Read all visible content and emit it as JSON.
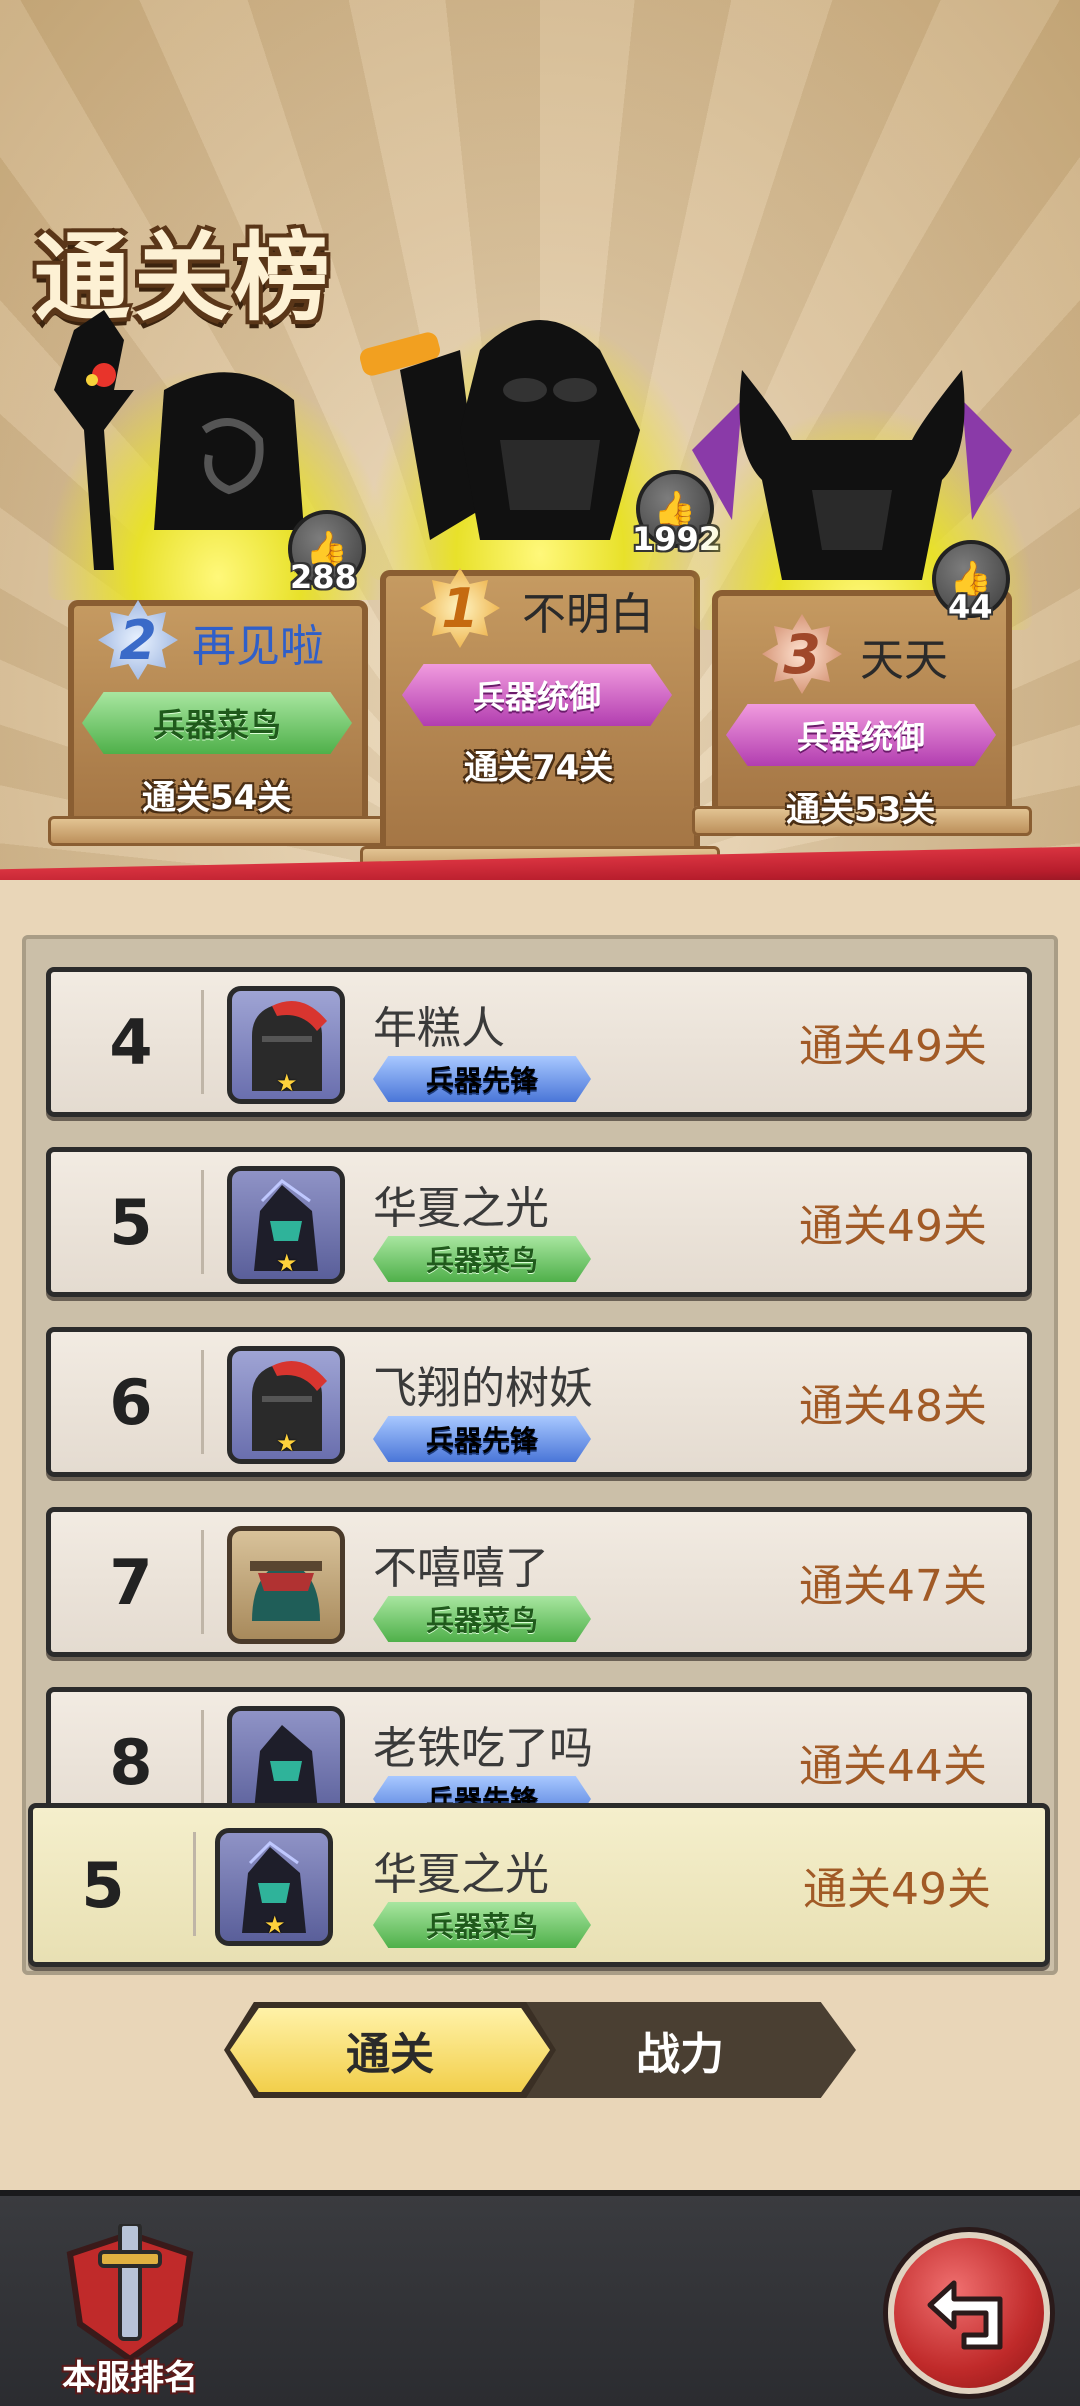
{
  "page": {
    "title": "通关榜"
  },
  "podium": [
    {
      "rank": "2",
      "name": "再见啦",
      "likes": "288",
      "title": "兵器菜鸟",
      "title_color": "green",
      "level": "通关54关"
    },
    {
      "rank": "1",
      "name": "不明白",
      "likes": "1992",
      "title": "兵器统御",
      "title_color": "purple",
      "level": "通关74关"
    },
    {
      "rank": "3",
      "name": "天天",
      "likes": "44",
      "title": "兵器统御",
      "title_color": "purple",
      "level": "通关53关"
    }
  ],
  "list": [
    {
      "rank": "4",
      "name": "年糕人",
      "tag": "兵器先锋",
      "tag_color": "blue",
      "level": "通关49关"
    },
    {
      "rank": "5",
      "name": "华夏之光",
      "tag": "兵器菜鸟",
      "tag_color": "green",
      "level": "通关49关"
    },
    {
      "rank": "6",
      "name": "飞翔的树妖",
      "tag": "兵器先锋",
      "tag_color": "blue",
      "level": "通关48关"
    },
    {
      "rank": "7",
      "name": "不嘻嘻了",
      "tag": "兵器菜鸟",
      "tag_color": "green",
      "level": "通关47关"
    },
    {
      "rank": "8",
      "name": "老铁吃了吗",
      "tag": "兵器先锋",
      "tag_color": "blue",
      "level": "通关44关"
    }
  ],
  "my_rank": {
    "rank": "5",
    "name": "华夏之光",
    "tag": "兵器菜鸟",
    "tag_color": "green",
    "level": "通关49关"
  },
  "tabs": {
    "active": "通关",
    "inactive": "战力"
  },
  "bottom": {
    "server_rank_label": "本服排名"
  },
  "colors": {
    "accent_red": "#c02a2a",
    "level_text": "#a15a26",
    "toggle_active": "#f2cf4b"
  }
}
